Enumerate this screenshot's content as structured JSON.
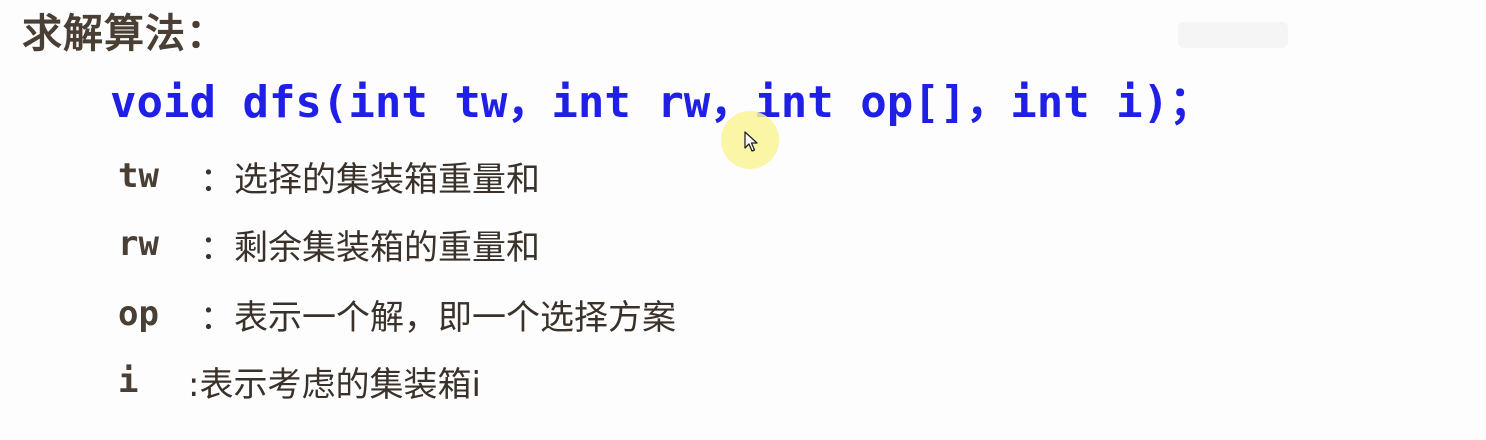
{
  "slide": {
    "title": "求解算法：",
    "code_signature": "void dfs(int tw，int rw，int op[]，int i)；",
    "params": [
      {
        "name": "tw",
        "desc": "：选择的集装箱重量和"
      },
      {
        "name": "rw",
        "desc": "：剩余集装箱的重量和"
      },
      {
        "name": "op",
        "desc": "：表示一个解，即一个选择方案"
      },
      {
        "name": "i",
        "desc": ":表示考虑的集装箱i"
      }
    ]
  },
  "cursor": {
    "icon": "mouse-pointer-icon",
    "highlight_color": "#faf596"
  },
  "colors": {
    "code": "#1f1fe6",
    "text": "#4a3f34",
    "background": "#fdfdfd"
  }
}
